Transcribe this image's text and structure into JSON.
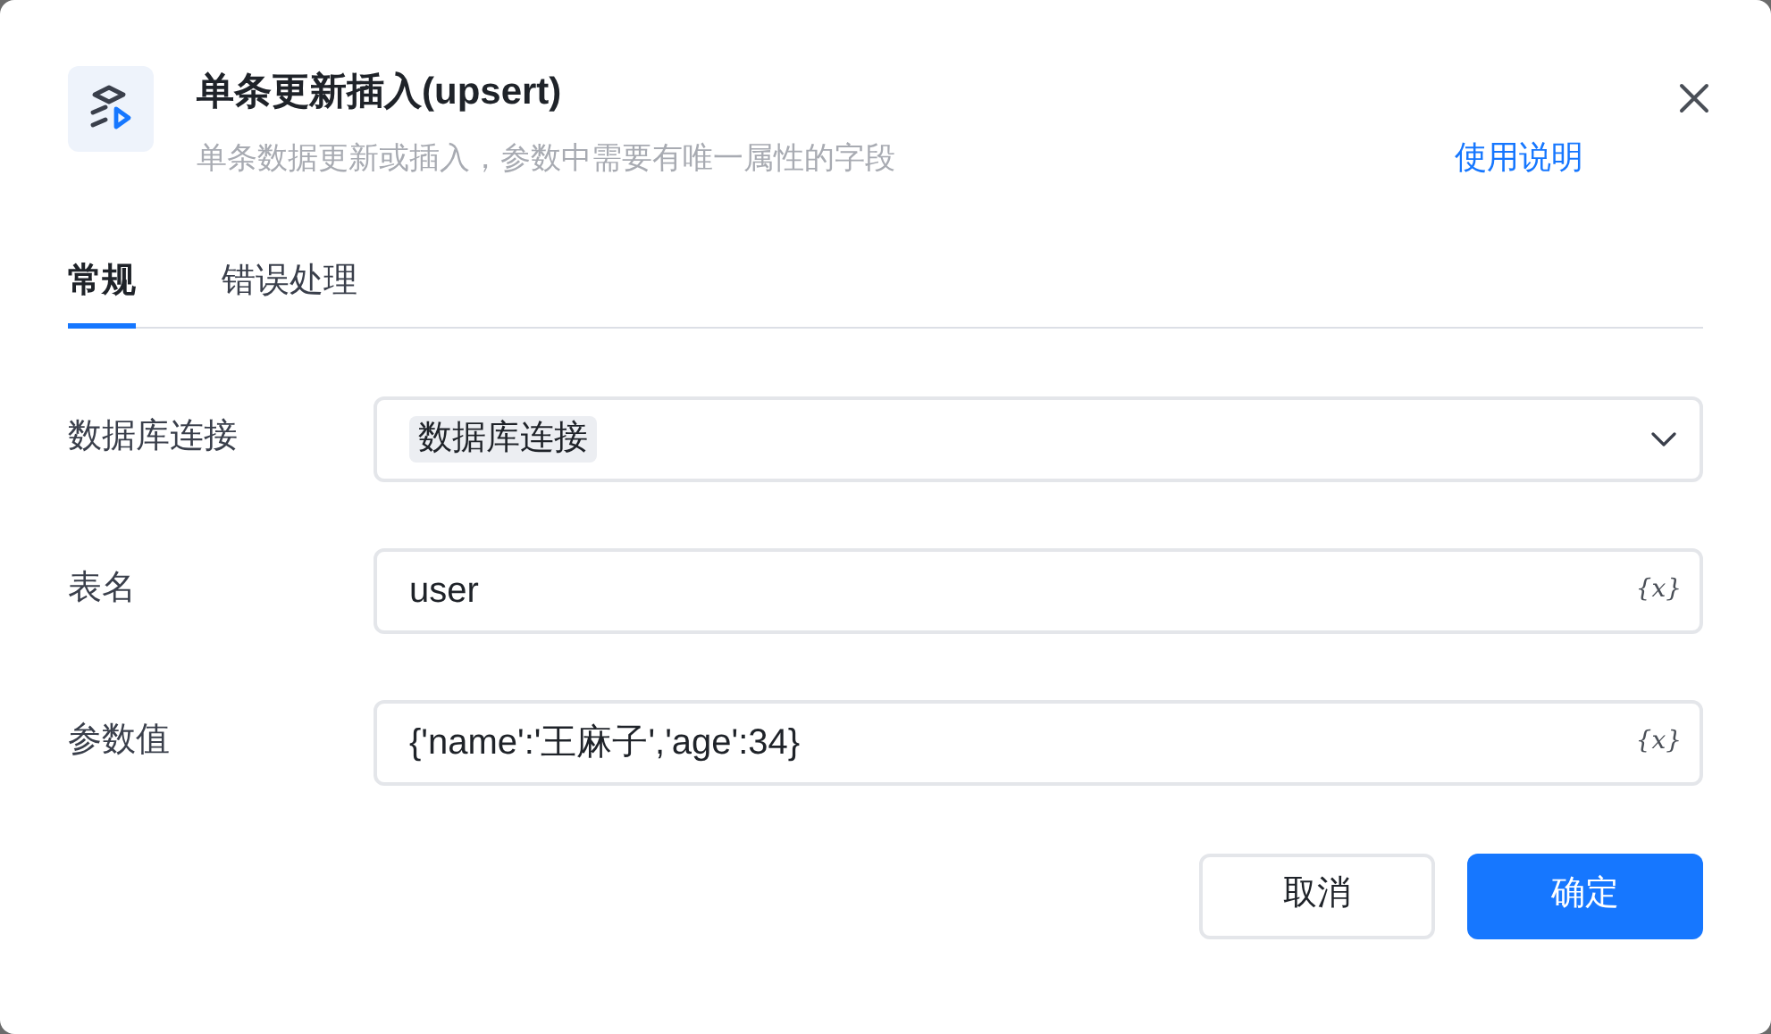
{
  "dialog": {
    "title": "单条更新插入(upsert)",
    "subtitle": "单条数据更新或插入，参数中需要有唯一属性的字段",
    "help_link": "使用说明"
  },
  "tabs": [
    {
      "label": "常规",
      "selected": true
    },
    {
      "label": "错误处理",
      "selected": false
    }
  ],
  "fields": [
    {
      "kind": "select",
      "label": "数据库连接",
      "tag": "数据库连接"
    },
    {
      "kind": "input",
      "label": "表名",
      "value": "user",
      "variable_button": "{x}"
    },
    {
      "kind": "input",
      "label": "参数值",
      "value": "{'name':'王麻子','age':34}",
      "variable_button": "{x}"
    }
  ],
  "buttons": [
    {
      "label": "取消",
      "kind": "secondary"
    },
    {
      "label": "确定",
      "kind": "primary"
    }
  ]
}
